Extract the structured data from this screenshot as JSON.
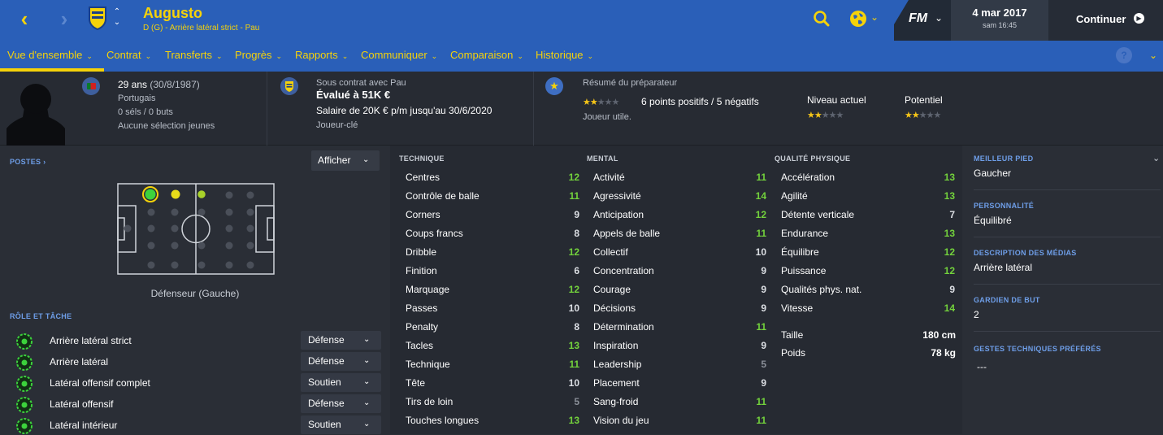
{
  "header": {
    "player_name": "Augusto",
    "player_subtitle": "D (G) - Arrière latéral strict - Pau",
    "fm_logo": "FM",
    "date": "4 mar 2017",
    "time": "sam 16:45",
    "continue_label": "Continuer",
    "colors": {
      "header_bg": "#2a5fb8",
      "accent": "#f5d20a"
    }
  },
  "tabs": [
    {
      "label": "Vue d'ensemble"
    },
    {
      "label": "Contrat"
    },
    {
      "label": "Transferts"
    },
    {
      "label": "Progrès"
    },
    {
      "label": "Rapports"
    },
    {
      "label": "Communiquer"
    },
    {
      "label": "Comparaison"
    },
    {
      "label": "Historique"
    }
  ],
  "help_label": "?",
  "info": {
    "age": "29 ans",
    "dob": "(30/8/1987)",
    "nationality": "Portugais",
    "caps": "0 séls / 0 buts",
    "youth": "Aucune sélection jeunes",
    "contract_club": "Sous contrat avec Pau",
    "valued": "Évalué à 51K €",
    "salary": "Salaire de 20K € p/m jusqu'au 30/6/2020",
    "role": "Joueur-clé",
    "coach_title": "Résumé du préparateur",
    "coach_rating": 2,
    "coach_points": "6 points positifs / 5 négatifs",
    "coach_summary": "Joueur utile.",
    "niveau_label": "Niveau actuel",
    "niveau_rating": 2,
    "potentiel_label": "Potentiel",
    "potentiel_rating": 2
  },
  "left": {
    "postes_label": "POSTES ›",
    "afficher_label": "Afficher",
    "position_label": "Défenseur (Gauche)",
    "role_section_label": "RÔLE ET TÂCHE",
    "roles": [
      {
        "name": "Arrière latéral strict",
        "duty": "Défense"
      },
      {
        "name": "Arrière latéral",
        "duty": "Défense"
      },
      {
        "name": "Latéral offensif complet",
        "duty": "Soutien"
      },
      {
        "name": "Latéral offensif",
        "duty": "Défense"
      },
      {
        "name": "Latéral intérieur",
        "duty": "Soutien"
      }
    ]
  },
  "attributes": {
    "technique_header": "TECHNIQUE",
    "mental_header": "MENTAL",
    "physical_header": "QUALITÉ PHYSIQUE",
    "technique": [
      {
        "name": "Centres",
        "value": "12"
      },
      {
        "name": "Contrôle de balle",
        "value": "11"
      },
      {
        "name": "Corners",
        "value": "9"
      },
      {
        "name": "Coups francs",
        "value": "8"
      },
      {
        "name": "Dribble",
        "value": "12"
      },
      {
        "name": "Finition",
        "value": "6"
      },
      {
        "name": "Marquage",
        "value": "12"
      },
      {
        "name": "Passes",
        "value": "10"
      },
      {
        "name": "Penalty",
        "value": "8"
      },
      {
        "name": "Tacles",
        "value": "13"
      },
      {
        "name": "Technique",
        "value": "11"
      },
      {
        "name": "Tête",
        "value": "10"
      },
      {
        "name": "Tirs de loin",
        "value": "5"
      },
      {
        "name": "Touches longues",
        "value": "13"
      }
    ],
    "mental": [
      {
        "name": "Activité",
        "value": "11"
      },
      {
        "name": "Agressivité",
        "value": "14"
      },
      {
        "name": "Anticipation",
        "value": "12"
      },
      {
        "name": "Appels de balle",
        "value": "11"
      },
      {
        "name": "Collectif",
        "value": "10"
      },
      {
        "name": "Concentration",
        "value": "9"
      },
      {
        "name": "Courage",
        "value": "9"
      },
      {
        "name": "Décisions",
        "value": "9"
      },
      {
        "name": "Détermination",
        "value": "11"
      },
      {
        "name": "Inspiration",
        "value": "9"
      },
      {
        "name": "Leadership",
        "value": "5"
      },
      {
        "name": "Placement",
        "value": "9"
      },
      {
        "name": "Sang-froid",
        "value": "11"
      },
      {
        "name": "Vision du jeu",
        "value": "11"
      }
    ],
    "physical": [
      {
        "name": "Accélération",
        "value": "13"
      },
      {
        "name": "Agilité",
        "value": "13"
      },
      {
        "name": "Détente verticale",
        "value": "7"
      },
      {
        "name": "Endurance",
        "value": "13"
      },
      {
        "name": "Équilibre",
        "value": "12"
      },
      {
        "name": "Puissance",
        "value": "12"
      },
      {
        "name": "Qualités phys. nat.",
        "value": "9"
      },
      {
        "name": "Vitesse",
        "value": "14"
      }
    ],
    "height_label": "Taille",
    "height_value": "180 cm",
    "weight_label": "Poids",
    "weight_value": "78 kg"
  },
  "right": {
    "best_foot_label": "MEILLEUR PIED",
    "best_foot_value": "Gaucher",
    "personality_label": "PERSONNALITÉ",
    "personality_value": "Équilibré",
    "media_label": "DESCRIPTION DES MÉDIAS",
    "media_value": "Arrière latéral",
    "gk_label": "GARDIEN DE BUT",
    "gk_value": "2",
    "gestures_label": "GESTES TECHNIQUES PRÉFÉRÉS",
    "gestures_value": "---"
  }
}
